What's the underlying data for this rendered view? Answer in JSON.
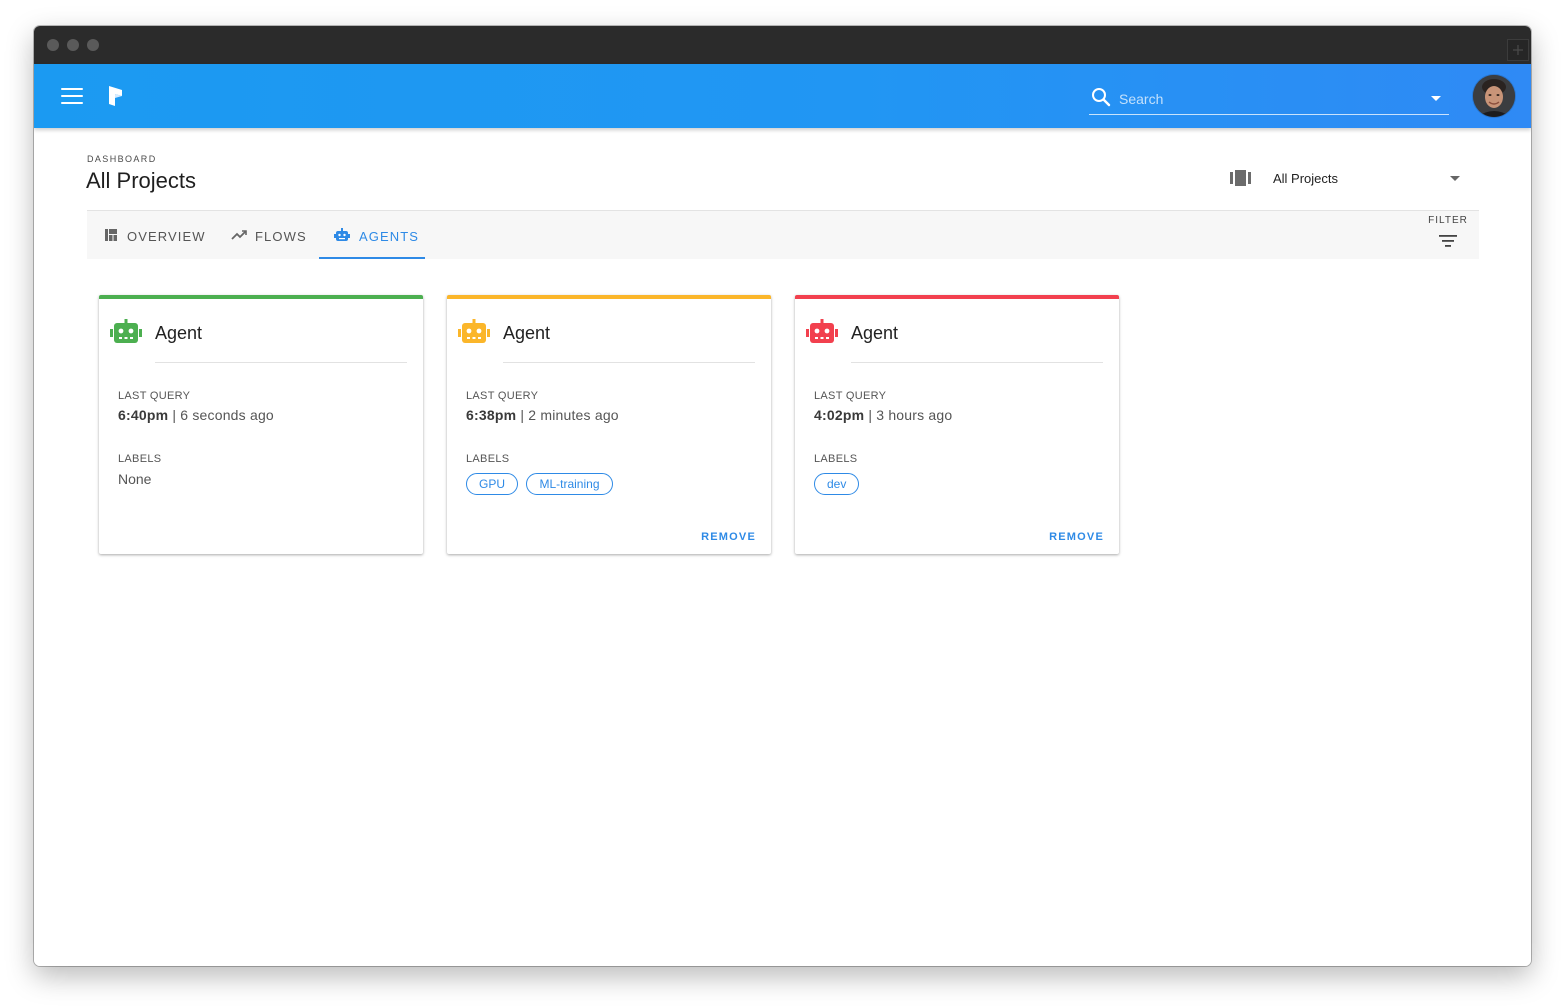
{
  "header": {
    "search_placeholder": "Search"
  },
  "page": {
    "breadcrumb": "DASHBOARD",
    "title": "All Projects",
    "project_select": "All Projects"
  },
  "tabs": [
    {
      "label": "OVERVIEW",
      "icon": "view-quilt-icon"
    },
    {
      "label": "FLOWS",
      "icon": "trending-up-icon"
    },
    {
      "label": "AGENTS",
      "icon": "robot-icon",
      "active": true
    }
  ],
  "filter_label": "FILTER",
  "agents": [
    {
      "name": "Agent",
      "status_color": "#4caf50",
      "last_query_label": "LAST QUERY",
      "last_query_time": "6:40pm",
      "last_query_ago": " | 6 seconds ago",
      "labels_label": "LABELS",
      "labels_none": "None",
      "labels": []
    },
    {
      "name": "Agent",
      "status_color": "#fbb62a",
      "last_query_label": "LAST QUERY",
      "last_query_time": "6:38pm",
      "last_query_ago": " | 2 minutes ago",
      "labels_label": "LABELS",
      "labels": [
        "GPU",
        "ML-training"
      ],
      "remove_label": "REMOVE"
    },
    {
      "name": "Agent",
      "status_color": "#f2404e",
      "last_query_label": "LAST QUERY",
      "last_query_time": "4:02pm",
      "last_query_ago": " | 3 hours ago",
      "labels_label": "LABELS",
      "labels": [
        "dev"
      ],
      "remove_label": "REMOVE"
    }
  ],
  "colors": {
    "appbar": "#2196f3",
    "accent": "#2e8ae6",
    "healthy": "#4caf50",
    "warning": "#fbb62a",
    "error": "#f2404e"
  }
}
